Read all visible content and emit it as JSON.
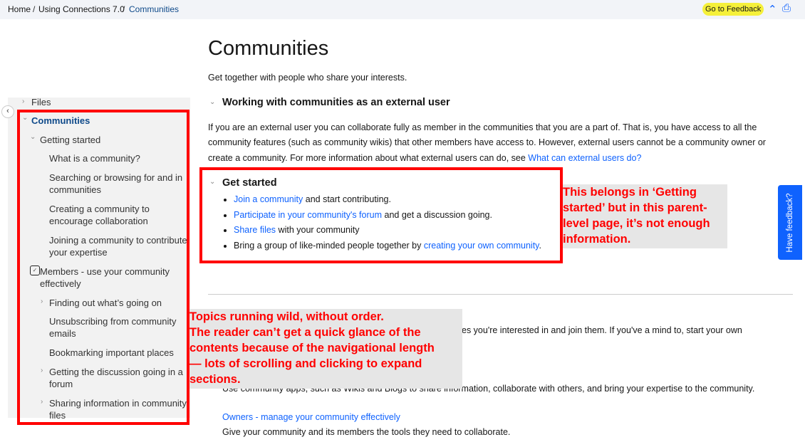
{
  "breadcrumb": [
    "Home",
    "Using Connections 7.0",
    "Communities"
  ],
  "breadcrumb_sep": "/",
  "topbar": {
    "feedback_label": "Go to Feedback",
    "collapse_icon": "⌃",
    "print_icon": "⎙"
  },
  "sidebar": {
    "collapse_icon": "‹",
    "items": {
      "files": "Files",
      "communities": "Communities",
      "getting_started": "Getting started",
      "what_is": "What is a community?",
      "searching_1": "Searching or browsing for and in",
      "searching_2": "communities",
      "creating_1": "Creating a community to",
      "creating_2": "encourage collaboration",
      "joining_1": "Joining a community to contribute",
      "joining_2": "your expertise",
      "members_1": "Members - use your community",
      "members_2": "effectively",
      "finding": "Finding out what’s going on",
      "unsub_1": "Unsubscribing from community",
      "unsub_2": "emails",
      "bookmarking": "Bookmarking important places",
      "discussion_1": "Getting the discussion going in a",
      "discussion_2": "forum",
      "sharing_1": "Sharing information in community",
      "sharing_2": "files"
    }
  },
  "main": {
    "title": "Communities",
    "intro": "Get together with people who share your interests.",
    "external_heading": "Working with communities as an external user",
    "external_p1": "If you are an external user you can collaborate fully as member in the communities that you are a part of. That is, you have access to all the",
    "external_p2": "community features (such as community wikis) that other members have access to. However, external users cannot be a community owner or",
    "external_p3": "create a community. For more information about what external users can do, see ",
    "external_link": "What can external users do?",
    "get_started_heading": "Get started",
    "bullets": {
      "b1_link": "Join a community",
      "b1_rest": " and start contributing.",
      "b2_link": "Participate in your community's forum",
      "b2_rest": " and get a discussion going.",
      "b3_link": "Share files",
      "b3_rest": " with your community",
      "b4_pre": "Bring a group of like-minded people together by ",
      "b4_link": "creating your own community",
      "b4_end": "."
    },
    "partial_1": "es you're interested in and join them. If you've a mind to, start your own",
    "partial_2": "Use community apps, such as Wikis and Blogs to share information, collaborate with others, and bring your expertise to the community.",
    "owners_link": "Owners - manage your community effectively",
    "owners_desc": "Give your community and its members the tools they need to collaborate."
  },
  "annotations": {
    "right_1": "This belongs in ‘Getting",
    "right_2": "started’ but in this parent-",
    "right_3": "level page, it’s not enough",
    "right_4": "information.",
    "left_1": "Topics running wild, without order.",
    "left_2": "The reader can’t get a quick glance of the",
    "left_3": "contents because of the navigational length",
    "left_4": "— lots of scrolling and clicking to expand",
    "left_5": "sections."
  },
  "have_feedback": "Have feedback?",
  "chevron_right": "›",
  "chevron_down": "⌄",
  "check_glyph": "✓"
}
